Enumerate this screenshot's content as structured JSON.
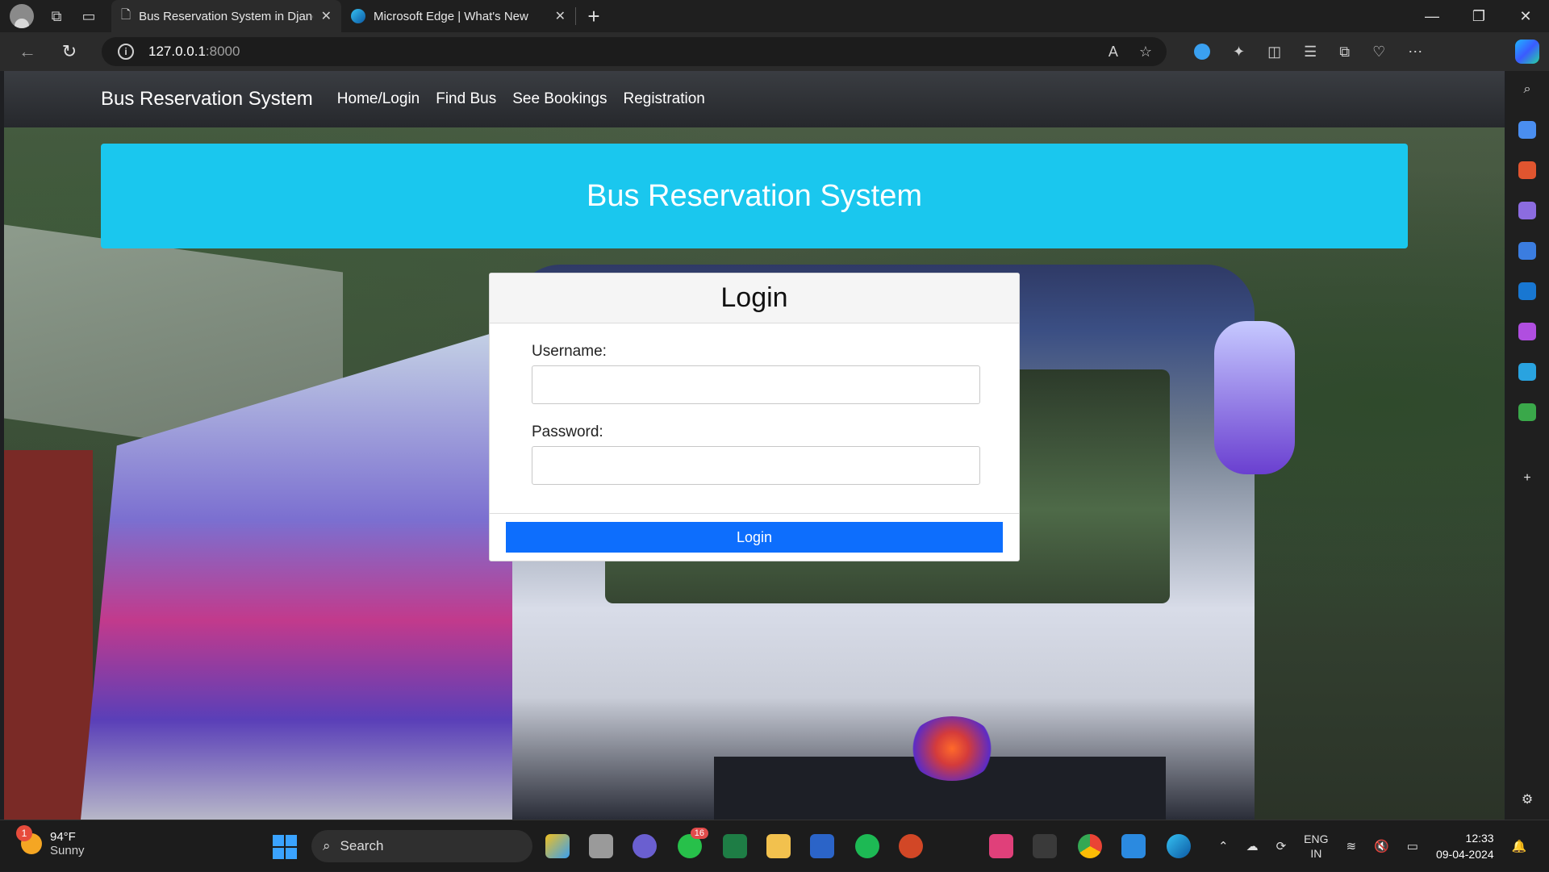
{
  "browser": {
    "tabs": [
      {
        "title": "Bus Reservation System in Djang",
        "active": true
      },
      {
        "title": "Microsoft Edge | What's New",
        "active": false
      }
    ],
    "url_host": "127.0.0.1",
    "url_port": ":8000"
  },
  "nav": {
    "brand": "Bus Reservation System",
    "links": [
      "Home/Login",
      "Find Bus",
      "See Bookings",
      "Registration"
    ]
  },
  "hero": {
    "title": "Bus Reservation System"
  },
  "login": {
    "title": "Login",
    "username_label": "Username:",
    "password_label": "Password:",
    "button": "Login"
  },
  "taskbar": {
    "weather_temp": "94°F",
    "weather_desc": "Sunny",
    "weather_badge": "1",
    "search_label": "Search",
    "whatsapp_badge": "16",
    "lang_top": "ENG",
    "lang_bottom": "IN",
    "time": "12:33",
    "date": "09-04-2024"
  },
  "colors": {
    "hero_bg": "#1ac7ee",
    "primary_button": "#0d6efd",
    "navbar": "#2b2d31"
  }
}
